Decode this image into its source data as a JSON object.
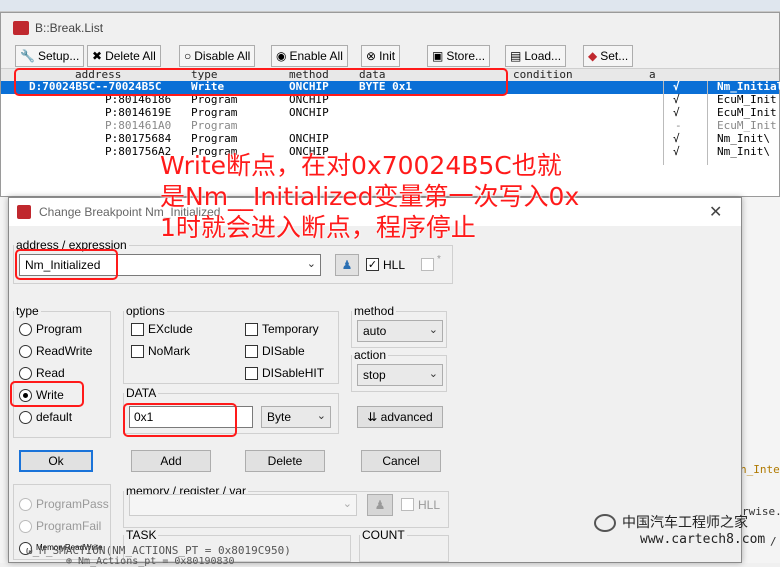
{
  "break_list": {
    "title": "B::Break.List",
    "toolbar": [
      {
        "label": "Setup...",
        "icon": "wrench-icon"
      },
      {
        "label": "Delete All",
        "icon": "x-icon"
      },
      {
        "label": "Disable All",
        "icon": "radio-empty-icon"
      },
      {
        "label": "Enable All",
        "icon": "radio-filled-icon"
      },
      {
        "label": "Init",
        "icon": "x-circle-icon"
      },
      {
        "label": "Store...",
        "icon": "store-icon"
      },
      {
        "label": "Load...",
        "icon": "load-icon"
      },
      {
        "label": "Set...",
        "icon": "set-icon"
      }
    ],
    "columns": {
      "address": "address",
      "type": "type",
      "method": "method",
      "data": "data",
      "condition": "condition",
      "a": "a"
    },
    "rows": [
      {
        "address": "D:70024B5C--70024B5C",
        "type": "Write",
        "method": "ONCHIP",
        "data": "BYTE 0x1",
        "check": "√",
        "name": "Nm_Initiali"
      },
      {
        "address": "P:80146186",
        "type": "Program",
        "method": "ONCHIP",
        "data": "",
        "check": "√",
        "name": "EcuM_Init"
      },
      {
        "address": "P:8014619E",
        "type": "Program",
        "method": "ONCHIP",
        "data": "",
        "check": "√",
        "name": "EcuM_Init"
      },
      {
        "address": "P:801461A0",
        "type": "Program",
        "method": "",
        "data": "",
        "check": "-",
        "name": "EcuM_Init"
      },
      {
        "address": "P:80175684",
        "type": "Program",
        "method": "ONCHIP",
        "data": "",
        "check": "√",
        "name": "Nm_Init\\"
      },
      {
        "address": "P:801756A2",
        "type": "Program",
        "method": "ONCHIP",
        "data": "",
        "check": "√",
        "name": "Nm_Init\\"
      }
    ]
  },
  "annotation": {
    "line1": "Write断点，在对0x70024B5C也就",
    "line2": "是Nm__Initialized变量第一次写入0x",
    "line3": "1时就会进入断点，程序停止"
  },
  "dialog": {
    "title": "Change Breakpoint Nm_Initialized",
    "close": "✕",
    "address_legend": "address / expression",
    "address_value": "Nm_Initialized",
    "hll_label": "HLL",
    "hll_checked": "✓",
    "type_legend": "type",
    "types": [
      "Program",
      "ReadWrite",
      "Read",
      "Write",
      "default",
      "ProgramPass",
      "ProgramFail",
      "MemoryReadWrite"
    ],
    "selected_type": "Write",
    "options_legend": "options",
    "options_left": [
      "EXclude",
      "NoMark"
    ],
    "options_right": [
      "Temporary",
      "DISable",
      "DISableHIT"
    ],
    "data_legend": "DATA",
    "data_value": "0x1",
    "data_size": "Byte",
    "method_legend": "method",
    "method_value": "auto",
    "action_legend": "action",
    "action_value": "stop",
    "advanced_label": "advanced",
    "ok": "Ok",
    "add": "Add",
    "delete": "Delete",
    "cancel": "Cancel",
    "memory_legend": "memory / register / var",
    "memory_hll": "HLL",
    "task_legend": "TASK",
    "count_legend": "COUNT"
  },
  "background_code": {
    "line1": "ω_M_SMACTION(NM_ACTIONS_PT = 0x8019C950)",
    "line2": "⊕ Nm_Actions_pt = 0x80190830",
    "right1": "n_Inte",
    "right2": "rwise.",
    "right3": "/"
  },
  "watermark": {
    "title": "中国汽车工程师之家",
    "url": "www.cartech8.com"
  },
  "colors": {
    "annotation": "#ff1a1a",
    "selection": "#0a6fd6",
    "default_button": "#1a73d9"
  }
}
